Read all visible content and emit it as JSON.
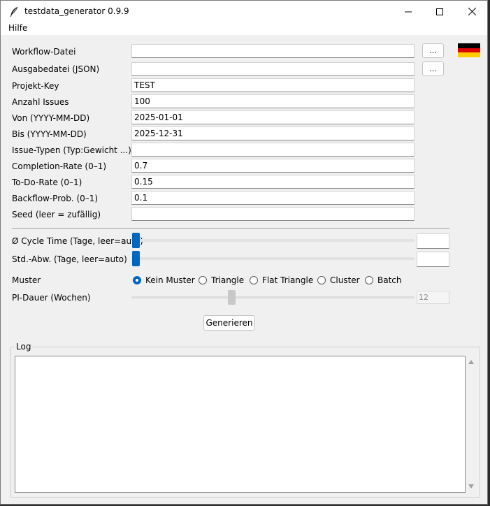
{
  "window": {
    "title": "testdata_generator 0.9.9"
  },
  "menu": {
    "items": [
      "Hilfe"
    ]
  },
  "fields": {
    "workflow": {
      "label": "Workflow-Datei",
      "value": ""
    },
    "output": {
      "label": "Ausgabedatei (JSON)",
      "value": ""
    },
    "project_key": {
      "label": "Projekt-Key",
      "value": "TEST"
    },
    "issue_count": {
      "label": "Anzahl Issues",
      "value": "100"
    },
    "from": {
      "label": "Von (YYYY-MM-DD)",
      "value": "2025-01-01"
    },
    "to": {
      "label": "Bis (YYYY-MM-DD)",
      "value": "2025-12-31"
    },
    "issue_types": {
      "label": "Issue-Typen (Typ:Gewicht ...)",
      "value": ""
    },
    "completion_rate": {
      "label": "Completion-Rate (0–1)",
      "value": "0.7"
    },
    "todo_rate": {
      "label": "To-Do-Rate (0–1)",
      "value": "0.15"
    },
    "backflow_prob": {
      "label": "Backflow-Prob. (0–1)",
      "value": "0.1"
    },
    "seed": {
      "label": "Seed (leer = zufällig)",
      "value": ""
    }
  },
  "browse_label": "...",
  "cycle_time": {
    "label": "Ø Cycle Time (Tage, leer=auto)",
    "value": ""
  },
  "std_dev": {
    "label": "Std.-Abw. (Tage, leer=auto)",
    "value": ""
  },
  "pattern": {
    "label": "Muster",
    "selected": "Kein Muster",
    "options": [
      "Kein Muster",
      "Triangle",
      "Flat Triangle",
      "Cluster",
      "Batch"
    ]
  },
  "pi_duration": {
    "label": "PI-Dauer (Wochen)",
    "value": "12",
    "slider_fraction": 0.35
  },
  "generate_label": "Generieren",
  "log": {
    "title": "Log",
    "content": ""
  },
  "colors": {
    "accent": "#0067c0",
    "flag": [
      "#000000",
      "#dd0000",
      "#ffce00"
    ]
  },
  "language_flag": "german-flag-icon"
}
